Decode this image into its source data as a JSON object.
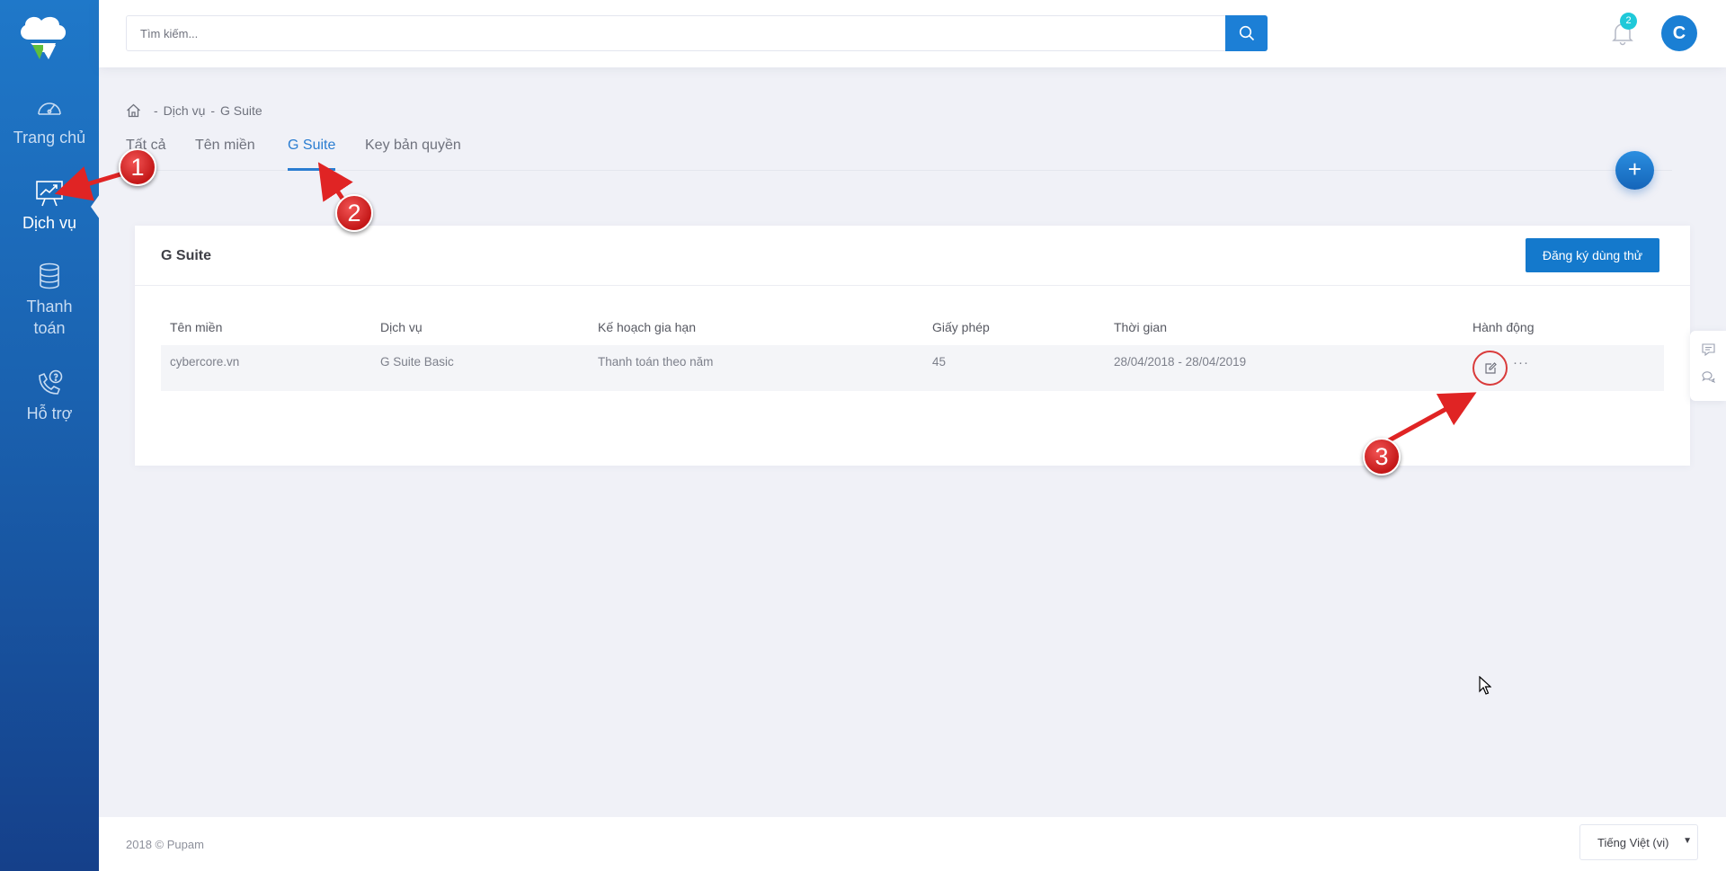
{
  "sidebar": {
    "items": [
      {
        "label": "Trang chủ",
        "icon": "speedometer-icon"
      },
      {
        "label": "Dịch vụ",
        "icon": "presentation-chart-icon",
        "active": true
      },
      {
        "label": "Thanh toán",
        "icon": "coins-icon"
      },
      {
        "label": "Hỗ trợ",
        "icon": "phone-support-icon"
      }
    ]
  },
  "header": {
    "search_placeholder": "Tìm kiếm...",
    "notification_count": "2",
    "avatar_initial": "C"
  },
  "breadcrumb": {
    "separator": "-",
    "items": [
      "Dịch vụ",
      "G Suite"
    ]
  },
  "tabs": [
    {
      "label": "Tất cả"
    },
    {
      "label": "Tên miền"
    },
    {
      "label": "G Suite",
      "active": true
    },
    {
      "label": "Key bản quyền"
    }
  ],
  "fab_label": "+",
  "card": {
    "title": "G Suite",
    "trial_button": "Đăng ký dùng thử",
    "columns": [
      "Tên miền",
      "Dịch vụ",
      "Kế hoạch gia hạn",
      "Giấy phép",
      "Thời gian",
      "Hành động"
    ],
    "rows": [
      {
        "domain": "cybercore.vn",
        "service": "G Suite Basic",
        "plan": "Thanh toán theo năm",
        "licenses": "45",
        "period": "28/04/2018 - 28/04/2019",
        "more": "···"
      }
    ]
  },
  "footer": {
    "copyright": "2018 © Pupam",
    "language": "Tiếng Việt (vi)"
  },
  "annotations": [
    "1",
    "2",
    "3"
  ],
  "colors": {
    "accent": "#1479cc",
    "sidebar_top": "#1f78c9",
    "sidebar_bottom": "#15408a",
    "annotation_red": "#d92020",
    "badge_cyan": "#1fc9d9"
  }
}
